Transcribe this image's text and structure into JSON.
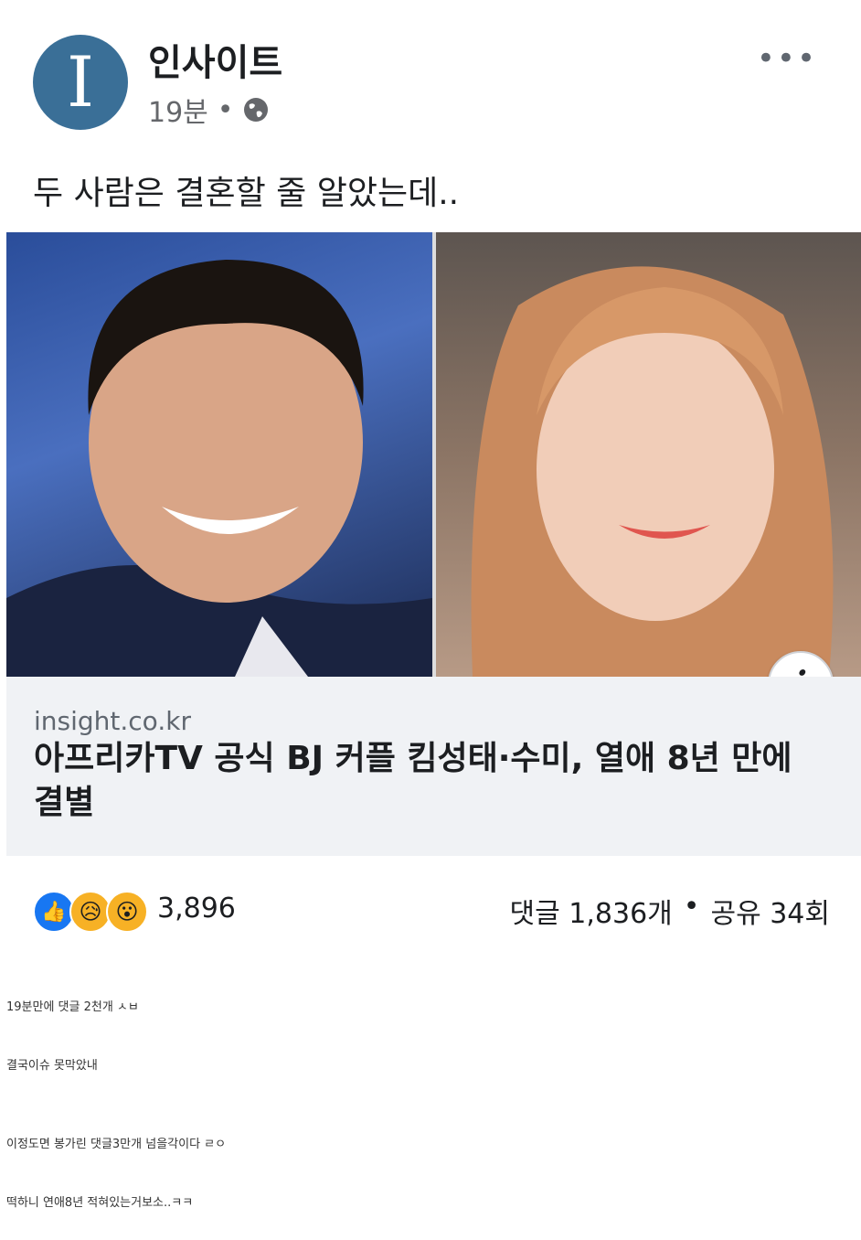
{
  "post": {
    "page_name": "인사이트",
    "avatar_letter": "I",
    "time": "19분",
    "dot": "•",
    "more": "•••",
    "text": "두 사람은 결혼할 줄 알았는데.."
  },
  "link": {
    "domain": "insight.co.kr",
    "headline": "아프리카TV 공식 BJ 커플 킴성태·수미, 열애 8년 만에 결별",
    "info": "i"
  },
  "reactions": {
    "icons": [
      "like-icon",
      "sad-icon",
      "wow-icon"
    ],
    "count": "3,896",
    "comments": "댓글 1,836개",
    "separator": "•",
    "shares": "공유 34회"
  },
  "comments": [
    "19분만에 댓글 2천개 ㅅㅂ",
    "결국이슈 못막았내",
    "이정도면 봉가린 댓글3만개 넘을각이다 ㄹㅇ",
    "떡하니 연애8년 적혀있는거보소..ㅋㅋ"
  ]
}
